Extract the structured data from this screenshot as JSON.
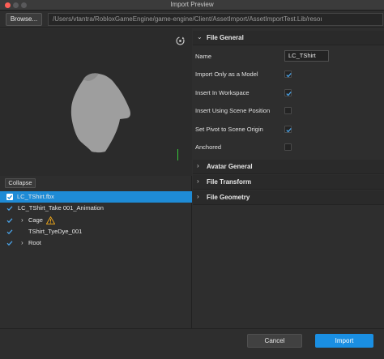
{
  "window": {
    "title": "Import Preview"
  },
  "toolbar": {
    "browse_label": "Browse...",
    "path": "/Users/vtantra/RobloxGameEngine/game-engine/Client/AssetImport/AssetImportTest.Lib/resoı"
  },
  "viewport": {
    "rotate_icon": "rotate-view-icon"
  },
  "hierarchy": {
    "collapse_label": "Collapse",
    "items": [
      {
        "label": "LC_TShirt.fbx",
        "checked": true,
        "selected": true
      },
      {
        "label": "LC_TShirt_Take 001_Animation",
        "checked": true
      },
      {
        "label": "Cage",
        "checked": true,
        "expandable": true,
        "warning": true
      },
      {
        "label": "TShirt_TyeDye_001",
        "checked": true
      },
      {
        "label": "Root",
        "checked": true,
        "expandable": true
      }
    ]
  },
  "properties": {
    "file_general": {
      "header": "File General",
      "name_label": "Name",
      "name_value": "LC_TShirt",
      "rows": [
        {
          "label": "Import Only as a Model",
          "checked": true
        },
        {
          "label": "Insert In Workspace",
          "checked": true
        },
        {
          "label": "Insert Using Scene Position",
          "checked": false
        },
        {
          "label": "Set Pivot to Scene Origin",
          "checked": true
        },
        {
          "label": "Anchored",
          "checked": false
        }
      ]
    },
    "collapsed_sections": [
      "Avatar General",
      "File Transform",
      "File Geometry"
    ]
  },
  "footer": {
    "cancel_label": "Cancel",
    "import_label": "Import"
  },
  "colors": {
    "accent": "#1a8fe3",
    "selection": "#1e8bd6",
    "background": "#2e2e2e"
  }
}
